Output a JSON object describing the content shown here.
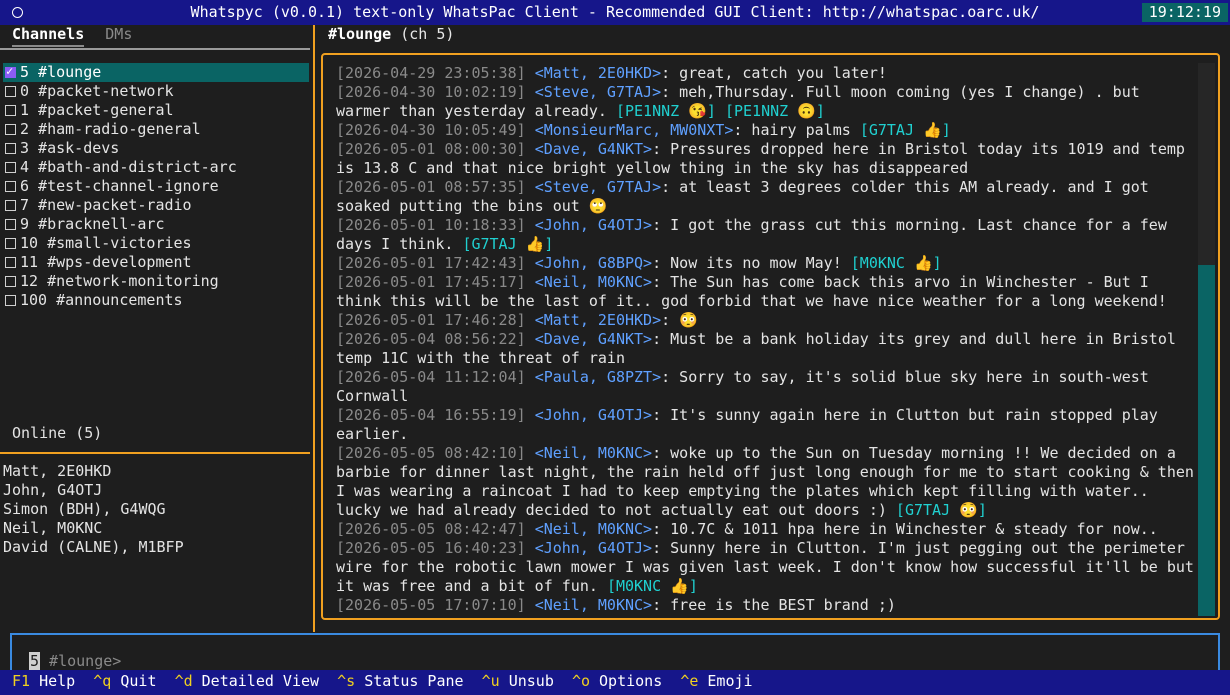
{
  "app": {
    "title": "Whatspyc (v0.0.1) text-only WhatsPac Client - Recommended GUI Client: http://whatspac.oarc.uk/",
    "clock": "19:12:19"
  },
  "sidebar": {
    "tabs": [
      {
        "label": "Channels",
        "active": true
      },
      {
        "label": "DMs",
        "active": false
      }
    ],
    "channels": [
      {
        "label": "5 #lounge",
        "selected": true
      },
      {
        "label": "0 #packet-network",
        "selected": false
      },
      {
        "label": "1 #packet-general",
        "selected": false
      },
      {
        "label": "2 #ham-radio-general",
        "selected": false
      },
      {
        "label": "3 #ask-devs",
        "selected": false
      },
      {
        "label": "4 #bath-and-district-arc",
        "selected": false
      },
      {
        "label": "6 #test-channel-ignore",
        "selected": false
      },
      {
        "label": "7 #new-packet-radio",
        "selected": false
      },
      {
        "label": "9 #bracknell-arc",
        "selected": false
      },
      {
        "label": "10 #small-victories",
        "selected": false
      },
      {
        "label": "11 #wps-development",
        "selected": false
      },
      {
        "label": "12 #network-monitoring",
        "selected": false
      },
      {
        "label": "100 #announcements",
        "selected": false
      }
    ],
    "online_title": "Online (5)",
    "online": [
      "Matt, 2E0HKD",
      "John, G4OTJ",
      "Simon (BDH), G4WQG",
      "Neil, M0KNC",
      "David (CALNE), M1BFP"
    ]
  },
  "channel": {
    "name": "#lounge",
    "suffix": " (ch 5)"
  },
  "messages": [
    {
      "ts": "[2026-04-29 23:05:38]",
      "nick": "<Matt, 2E0HKD>",
      "text": ": great, catch you later!",
      "reactions": []
    },
    {
      "ts": "[2026-04-30 10:02:19]",
      "nick": "<Steve, G7TAJ>",
      "text": ": meh,Thursday. Full moon coming (yes I change) . but warmer than yesterday already.",
      "reactions": [
        "[PE1NNZ 😘]",
        "[PE1NNZ 🙃]"
      ]
    },
    {
      "ts": "[2026-04-30 10:05:49]",
      "nick": "<MonsieurMarc, MW0NXT>",
      "text": ": hairy palms",
      "reactions": [
        "[G7TAJ 👍]"
      ]
    },
    {
      "ts": "[2026-05-01 08:00:30]",
      "nick": "<Dave, G4NKT>",
      "text": ": Pressures dropped here in Bristol today its 1019 and temp is 13.8 C and that nice bright yellow thing in the sky has disappeared",
      "reactions": []
    },
    {
      "ts": "[2026-05-01 08:57:35]",
      "nick": "<Steve, G7TAJ>",
      "text": ": at least 3 degrees colder this AM already. and I got soaked putting the bins out 🙄",
      "reactions": []
    },
    {
      "ts": "[2026-05-01 10:18:33]",
      "nick": "<John, G4OTJ>",
      "text": ": I got the grass cut this morning. Last chance for a few days I think.",
      "reactions": [
        "[G7TAJ 👍]"
      ]
    },
    {
      "ts": "[2026-05-01 17:42:43]",
      "nick": "<John, G8BPQ>",
      "text": ": Now its no mow May!",
      "reactions": [
        "[M0KNC 👍]"
      ]
    },
    {
      "ts": "[2026-05-01 17:45:17]",
      "nick": "<Neil, M0KNC>",
      "text": ": The Sun has come back this arvo in Winchester - But I think this will be the last of it.. god forbid that we have nice weather for a long weekend!",
      "reactions": []
    },
    {
      "ts": "[2026-05-01 17:46:28]",
      "nick": "<Matt, 2E0HKD>",
      "text": ": 😳",
      "reactions": []
    },
    {
      "ts": "[2026-05-04 08:56:22]",
      "nick": "<Dave, G4NKT>",
      "text": ": Must be a bank holiday its grey and dull here in Bristol temp 11C with the threat of rain",
      "reactions": []
    },
    {
      "ts": "[2026-05-04 11:12:04]",
      "nick": "<Paula, G8PZT>",
      "text": ": Sorry to say, it's solid blue sky here in south-west Cornwall",
      "reactions": []
    },
    {
      "ts": "[2026-05-04 16:55:19]",
      "nick": "<John, G4OTJ>",
      "text": ": It's sunny again here in Clutton but rain stopped play earlier.",
      "reactions": []
    },
    {
      "ts": "[2026-05-05 08:42:10]",
      "nick": "<Neil, M0KNC>",
      "text": ": woke up to the Sun on Tuesday morning !! We decided on a barbie for dinner last night, the rain held off just long enough for me to start cooking & then I was wearing a raincoat I had to keep emptying the plates which kept filling with water.. lucky we had already decided to not actually eat out doors :)  ",
      "reactions": [
        "[G7TAJ 😳]"
      ]
    },
    {
      "ts": "[2026-05-05 08:42:47]",
      "nick": "<Neil, M0KNC>",
      "text": ": 10.7C & 1011 hpa here in Winchester  & steady for now..",
      "reactions": []
    },
    {
      "ts": "[2026-05-05 16:40:23]",
      "nick": "<John, G4OTJ>",
      "text": ": Sunny here in Clutton. I'm just pegging out the perimeter wire for the robotic lawn mower I was given last week. I don't know how successful it'll be but it was free and a bit of fun.",
      "reactions": [
        "[M0KNC 👍]"
      ]
    },
    {
      "ts": "[2026-05-05 17:07:10]",
      "nick": "<Neil, M0KNC>",
      "text": ": free is the BEST brand ;)",
      "reactions": []
    }
  ],
  "input": {
    "channel_num": "5",
    "prompt": " #lounge>"
  },
  "statusbar": [
    {
      "key": "F1",
      "label": " Help"
    },
    {
      "key": "^q",
      "label": " Quit"
    },
    {
      "key": "^d",
      "label": " Detailed View"
    },
    {
      "key": "^s",
      "label": " Status Pane"
    },
    {
      "key": "^u",
      "label": " Unsub"
    },
    {
      "key": "^o",
      "label": " Options"
    },
    {
      "key": "^e",
      "label": " Emoji"
    }
  ],
  "colors": {
    "title_bg": "#16168a",
    "accent_border": "#f0a020",
    "selection_bg": "#0a6464",
    "nick": "#5fa0ff",
    "reaction": "#20d0d0",
    "timestamp": "#8a8a8a",
    "input_border": "#3a8ae0"
  }
}
